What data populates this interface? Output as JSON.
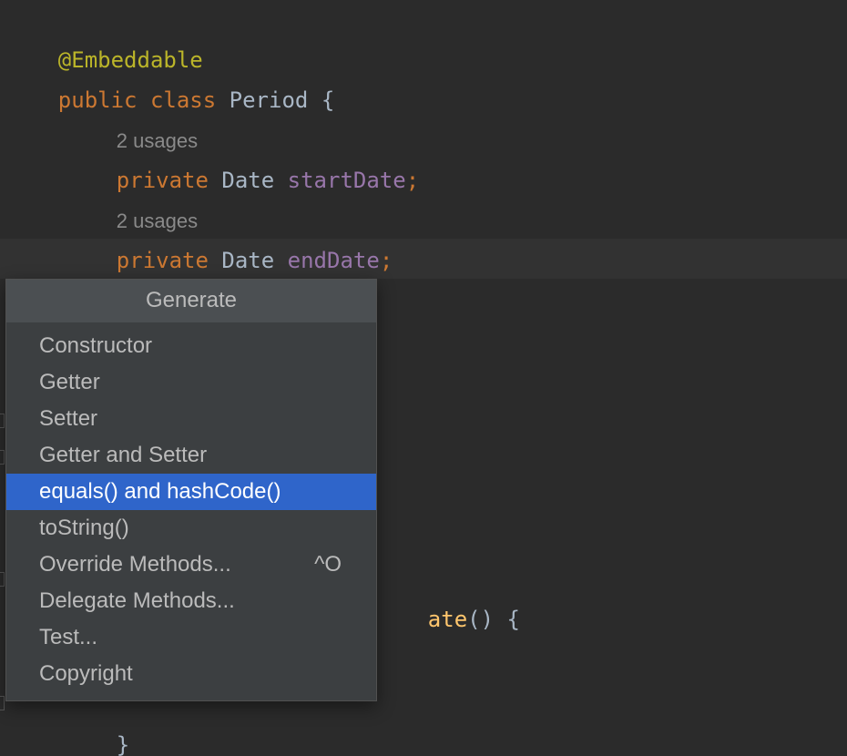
{
  "code": {
    "annotation": "@Embeddable",
    "class_decl": {
      "modifier": "public",
      "keyword": "class",
      "name": "Period",
      "brace": "{"
    },
    "usages_1": "2 usages",
    "field_1": {
      "modifier": "private",
      "type": "Date",
      "name": "startDate",
      "semicolon": ";"
    },
    "usages_2": "2 usages",
    "field_2": {
      "modifier": "private",
      "type": "Date",
      "name": "endDate",
      "semicolon": ";"
    },
    "partial_method": {
      "text_suffix": "ate",
      "parens": "()",
      "brace": "{"
    },
    "closing_brace_partial": "}"
  },
  "popup": {
    "title": "Generate",
    "items": [
      {
        "label": "Constructor",
        "shortcut": ""
      },
      {
        "label": "Getter",
        "shortcut": ""
      },
      {
        "label": "Setter",
        "shortcut": ""
      },
      {
        "label": "Getter and Setter",
        "shortcut": ""
      },
      {
        "label": "equals() and hashCode()",
        "shortcut": "",
        "selected": true
      },
      {
        "label": "toString()",
        "shortcut": ""
      },
      {
        "label": "Override Methods...",
        "shortcut": "^O"
      },
      {
        "label": "Delegate Methods...",
        "shortcut": ""
      },
      {
        "label": "Test...",
        "shortcut": ""
      },
      {
        "label": "Copyright",
        "shortcut": ""
      }
    ]
  },
  "colors": {
    "editor_bg": "#2b2b2b",
    "keyword": "#cc7832",
    "annotation": "#bbb529",
    "field": "#9876aa",
    "type": "#a9b7c6",
    "selection": "#2f65ca",
    "popup_bg": "#3c3f41"
  }
}
